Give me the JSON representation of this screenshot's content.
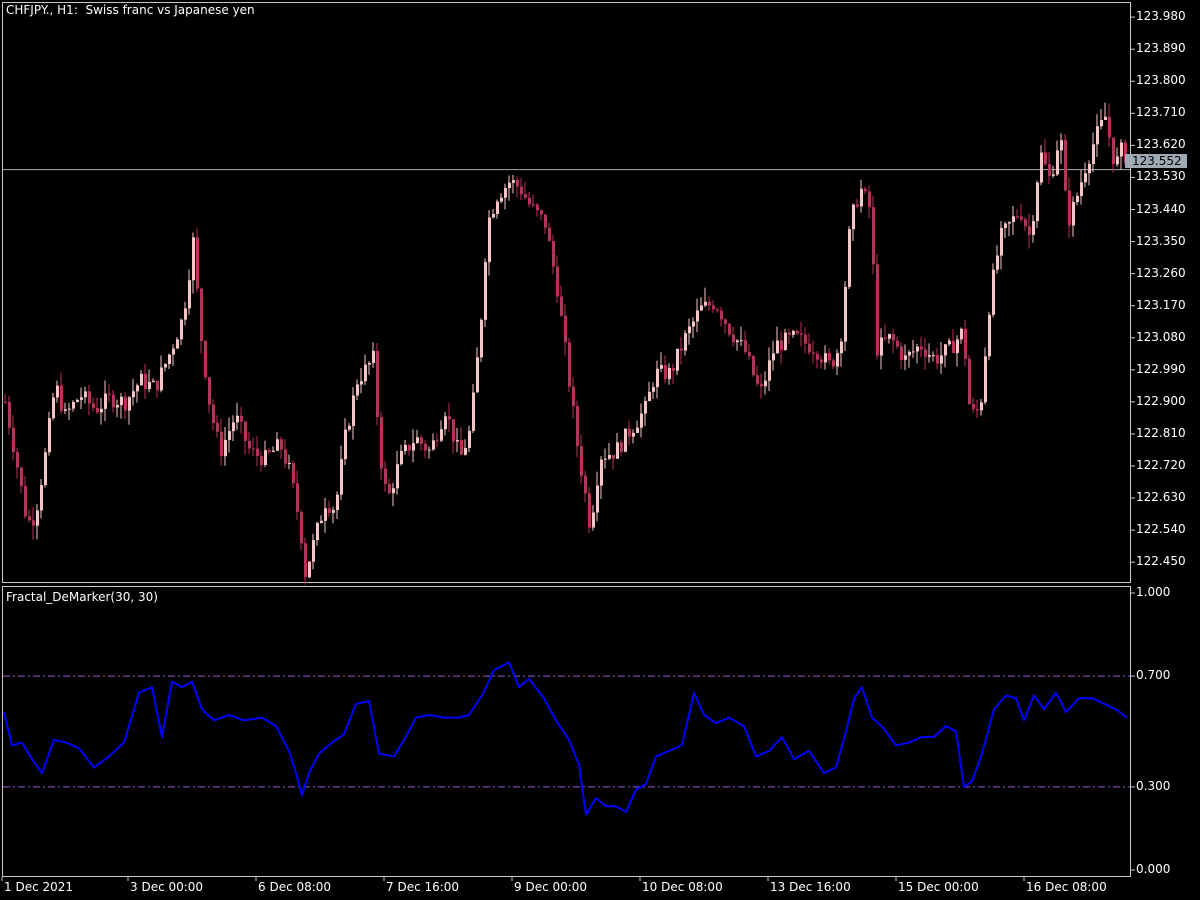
{
  "header": {
    "symbol_title": "CHFJPY., H1:  Swiss franc vs Japanese yen",
    "indicator_title": "Fractal_DeMarker(30, 30)"
  },
  "colors": {
    "background": "#000000",
    "bull_candle": "#f4c6c6",
    "bear_candle": "#b8325a",
    "indicator_line": "#0000ff",
    "level_line": "#9a5ad2",
    "price_line": "#a0aab4"
  },
  "price_axis": {
    "labels": [
      "123.980",
      "123.890",
      "123.800",
      "123.710",
      "123.620",
      "123.530",
      "123.440",
      "123.350",
      "123.260",
      "123.170",
      "123.080",
      "122.990",
      "122.900",
      "122.810",
      "122.720",
      "122.630",
      "122.540",
      "122.450"
    ]
  },
  "current_price": "123.552",
  "indicator_axis": {
    "labels": [
      "1.000",
      "0.700",
      "0.300",
      "0.000"
    ]
  },
  "time_axis": {
    "labels": [
      "1 Dec 2021",
      "3 Dec 00:00",
      "6 Dec 08:00",
      "7 Dec 16:00",
      "9 Dec 00:00",
      "10 Dec 08:00",
      "13 Dec 16:00",
      "15 Dec 00:00",
      "16 Dec 08:00"
    ]
  },
  "chart_data": [
    {
      "type": "candlestick",
      "title": "CHFJPY., H1:  Swiss franc vs Japanese yen",
      "ylim": [
        122.4,
        124.0
      ],
      "current_price": 123.552,
      "close_path": [
        {
          "x": 0,
          "v": 122.9
        },
        {
          "x": 12,
          "v": 122.72
        },
        {
          "x": 22,
          "v": 122.56
        },
        {
          "x": 30,
          "v": 122.58
        },
        {
          "x": 40,
          "v": 122.75
        },
        {
          "x": 50,
          "v": 122.95
        },
        {
          "x": 60,
          "v": 122.86
        },
        {
          "x": 75,
          "v": 122.92
        },
        {
          "x": 90,
          "v": 122.88
        },
        {
          "x": 105,
          "v": 122.91
        },
        {
          "x": 120,
          "v": 122.9
        },
        {
          "x": 135,
          "v": 122.96
        },
        {
          "x": 150,
          "v": 122.94
        },
        {
          "x": 165,
          "v": 123.04
        },
        {
          "x": 178,
          "v": 123.14
        },
        {
          "x": 188,
          "v": 123.35
        },
        {
          "x": 195,
          "v": 123.1
        },
        {
          "x": 205,
          "v": 122.88
        },
        {
          "x": 215,
          "v": 122.76
        },
        {
          "x": 230,
          "v": 122.86
        },
        {
          "x": 245,
          "v": 122.76
        },
        {
          "x": 260,
          "v": 122.74
        },
        {
          "x": 275,
          "v": 122.78
        },
        {
          "x": 285,
          "v": 122.7
        },
        {
          "x": 295,
          "v": 122.55
        },
        {
          "x": 300,
          "v": 122.42
        },
        {
          "x": 310,
          "v": 122.52
        },
        {
          "x": 320,
          "v": 122.62
        },
        {
          "x": 330,
          "v": 122.6
        },
        {
          "x": 340,
          "v": 122.8
        },
        {
          "x": 352,
          "v": 122.96
        },
        {
          "x": 368,
          "v": 123.02
        },
        {
          "x": 375,
          "v": 122.75
        },
        {
          "x": 382,
          "v": 122.62
        },
        {
          "x": 395,
          "v": 122.74
        },
        {
          "x": 410,
          "v": 122.8
        },
        {
          "x": 425,
          "v": 122.76
        },
        {
          "x": 440,
          "v": 122.88
        },
        {
          "x": 455,
          "v": 122.74
        },
        {
          "x": 465,
          "v": 122.82
        },
        {
          "x": 475,
          "v": 123.1
        },
        {
          "x": 482,
          "v": 123.4
        },
        {
          "x": 492,
          "v": 123.48
        },
        {
          "x": 505,
          "v": 123.52
        },
        {
          "x": 515,
          "v": 123.5
        },
        {
          "x": 525,
          "v": 123.45
        },
        {
          "x": 540,
          "v": 123.4
        },
        {
          "x": 552,
          "v": 123.22
        },
        {
          "x": 562,
          "v": 123.0
        },
        {
          "x": 572,
          "v": 122.78
        },
        {
          "x": 585,
          "v": 122.55
        },
        {
          "x": 595,
          "v": 122.75
        },
        {
          "x": 610,
          "v": 122.76
        },
        {
          "x": 625,
          "v": 122.82
        },
        {
          "x": 640,
          "v": 122.88
        },
        {
          "x": 650,
          "v": 122.98
        },
        {
          "x": 665,
          "v": 122.98
        },
        {
          "x": 680,
          "v": 123.08
        },
        {
          "x": 695,
          "v": 123.16
        },
        {
          "x": 710,
          "v": 123.18
        },
        {
          "x": 725,
          "v": 123.1
        },
        {
          "x": 740,
          "v": 123.04
        },
        {
          "x": 755,
          "v": 122.92
        },
        {
          "x": 770,
          "v": 123.06
        },
        {
          "x": 790,
          "v": 123.08
        },
        {
          "x": 810,
          "v": 123.05
        },
        {
          "x": 825,
          "v": 123.0
        },
        {
          "x": 835,
          "v": 123.06
        },
        {
          "x": 845,
          "v": 123.4
        },
        {
          "x": 855,
          "v": 123.5
        },
        {
          "x": 865,
          "v": 123.44
        },
        {
          "x": 872,
          "v": 123.05
        },
        {
          "x": 885,
          "v": 123.08
        },
        {
          "x": 900,
          "v": 123.02
        },
        {
          "x": 915,
          "v": 123.06
        },
        {
          "x": 930,
          "v": 123.02
        },
        {
          "x": 945,
          "v": 123.05
        },
        {
          "x": 958,
          "v": 123.1
        },
        {
          "x": 965,
          "v": 122.86
        },
        {
          "x": 975,
          "v": 122.88
        },
        {
          "x": 985,
          "v": 123.2
        },
        {
          "x": 995,
          "v": 123.36
        },
        {
          "x": 1005,
          "v": 123.4
        },
        {
          "x": 1015,
          "v": 123.44
        },
        {
          "x": 1025,
          "v": 123.36
        },
        {
          "x": 1035,
          "v": 123.6
        },
        {
          "x": 1045,
          "v": 123.52
        },
        {
          "x": 1055,
          "v": 123.66
        },
        {
          "x": 1062,
          "v": 123.4
        },
        {
          "x": 1070,
          "v": 123.46
        },
        {
          "x": 1080,
          "v": 123.56
        },
        {
          "x": 1090,
          "v": 123.64
        },
        {
          "x": 1100,
          "v": 123.7
        },
        {
          "x": 1110,
          "v": 123.56
        },
        {
          "x": 1118,
          "v": 123.62
        },
        {
          "x": 1123,
          "v": 123.55
        }
      ]
    },
    {
      "type": "line",
      "title": "Fractal_DeMarker(30, 30)",
      "ylim": [
        0,
        1
      ],
      "levels": [
        0.7,
        0.3
      ],
      "series": [
        {
          "points": [
            {
              "x": 0,
              "y": 0.57
            },
            {
              "x": 8,
              "y": 0.45
            },
            {
              "x": 18,
              "y": 0.46
            },
            {
              "x": 28,
              "y": 0.4
            },
            {
              "x": 38,
              "y": 0.35
            },
            {
              "x": 50,
              "y": 0.47
            },
            {
              "x": 62,
              "y": 0.46
            },
            {
              "x": 75,
              "y": 0.44
            },
            {
              "x": 90,
              "y": 0.37
            },
            {
              "x": 105,
              "y": 0.41
            },
            {
              "x": 120,
              "y": 0.46
            },
            {
              "x": 135,
              "y": 0.64
            },
            {
              "x": 148,
              "y": 0.66
            },
            {
              "x": 158,
              "y": 0.48
            },
            {
              "x": 168,
              "y": 0.68
            },
            {
              "x": 178,
              "y": 0.66
            },
            {
              "x": 188,
              "y": 0.68
            },
            {
              "x": 198,
              "y": 0.58
            },
            {
              "x": 210,
              "y": 0.54
            },
            {
              "x": 225,
              "y": 0.56
            },
            {
              "x": 240,
              "y": 0.54
            },
            {
              "x": 258,
              "y": 0.55
            },
            {
              "x": 272,
              "y": 0.52
            },
            {
              "x": 285,
              "y": 0.43
            },
            {
              "x": 292,
              "y": 0.35
            },
            {
              "x": 298,
              "y": 0.27
            },
            {
              "x": 305,
              "y": 0.35
            },
            {
              "x": 315,
              "y": 0.42
            },
            {
              "x": 328,
              "y": 0.46
            },
            {
              "x": 340,
              "y": 0.49
            },
            {
              "x": 352,
              "y": 0.6
            },
            {
              "x": 365,
              "y": 0.61
            },
            {
              "x": 375,
              "y": 0.42
            },
            {
              "x": 390,
              "y": 0.41
            },
            {
              "x": 400,
              "y": 0.47
            },
            {
              "x": 412,
              "y": 0.55
            },
            {
              "x": 425,
              "y": 0.56
            },
            {
              "x": 440,
              "y": 0.55
            },
            {
              "x": 455,
              "y": 0.55
            },
            {
              "x": 465,
              "y": 0.56
            },
            {
              "x": 478,
              "y": 0.63
            },
            {
              "x": 490,
              "y": 0.72
            },
            {
              "x": 505,
              "y": 0.75
            },
            {
              "x": 515,
              "y": 0.66
            },
            {
              "x": 525,
              "y": 0.69
            },
            {
              "x": 540,
              "y": 0.62
            },
            {
              "x": 552,
              "y": 0.54
            },
            {
              "x": 565,
              "y": 0.47
            },
            {
              "x": 575,
              "y": 0.38
            },
            {
              "x": 582,
              "y": 0.2
            },
            {
              "x": 592,
              "y": 0.26
            },
            {
              "x": 602,
              "y": 0.23
            },
            {
              "x": 612,
              "y": 0.23
            },
            {
              "x": 622,
              "y": 0.21
            },
            {
              "x": 632,
              "y": 0.29
            },
            {
              "x": 642,
              "y": 0.31
            },
            {
              "x": 652,
              "y": 0.41
            },
            {
              "x": 665,
              "y": 0.43
            },
            {
              "x": 678,
              "y": 0.45
            },
            {
              "x": 690,
              "y": 0.64
            },
            {
              "x": 700,
              "y": 0.56
            },
            {
              "x": 712,
              "y": 0.53
            },
            {
              "x": 725,
              "y": 0.55
            },
            {
              "x": 740,
              "y": 0.52
            },
            {
              "x": 752,
              "y": 0.41
            },
            {
              "x": 765,
              "y": 0.43
            },
            {
              "x": 778,
              "y": 0.48
            },
            {
              "x": 790,
              "y": 0.4
            },
            {
              "x": 805,
              "y": 0.43
            },
            {
              "x": 820,
              "y": 0.35
            },
            {
              "x": 832,
              "y": 0.37
            },
            {
              "x": 842,
              "y": 0.5
            },
            {
              "x": 850,
              "y": 0.62
            },
            {
              "x": 858,
              "y": 0.66
            },
            {
              "x": 868,
              "y": 0.55
            },
            {
              "x": 880,
              "y": 0.51
            },
            {
              "x": 892,
              "y": 0.45
            },
            {
              "x": 905,
              "y": 0.46
            },
            {
              "x": 918,
              "y": 0.48
            },
            {
              "x": 930,
              "y": 0.48
            },
            {
              "x": 942,
              "y": 0.52
            },
            {
              "x": 952,
              "y": 0.5
            },
            {
              "x": 960,
              "y": 0.3
            },
            {
              "x": 968,
              "y": 0.32
            },
            {
              "x": 978,
              "y": 0.42
            },
            {
              "x": 990,
              "y": 0.58
            },
            {
              "x": 1002,
              "y": 0.63
            },
            {
              "x": 1012,
              "y": 0.62
            },
            {
              "x": 1020,
              "y": 0.54
            },
            {
              "x": 1030,
              "y": 0.63
            },
            {
              "x": 1040,
              "y": 0.58
            },
            {
              "x": 1052,
              "y": 0.64
            },
            {
              "x": 1062,
              "y": 0.57
            },
            {
              "x": 1075,
              "y": 0.62
            },
            {
              "x": 1088,
              "y": 0.62
            },
            {
              "x": 1100,
              "y": 0.6
            },
            {
              "x": 1112,
              "y": 0.58
            },
            {
              "x": 1123,
              "y": 0.55
            }
          ]
        }
      ]
    }
  ]
}
